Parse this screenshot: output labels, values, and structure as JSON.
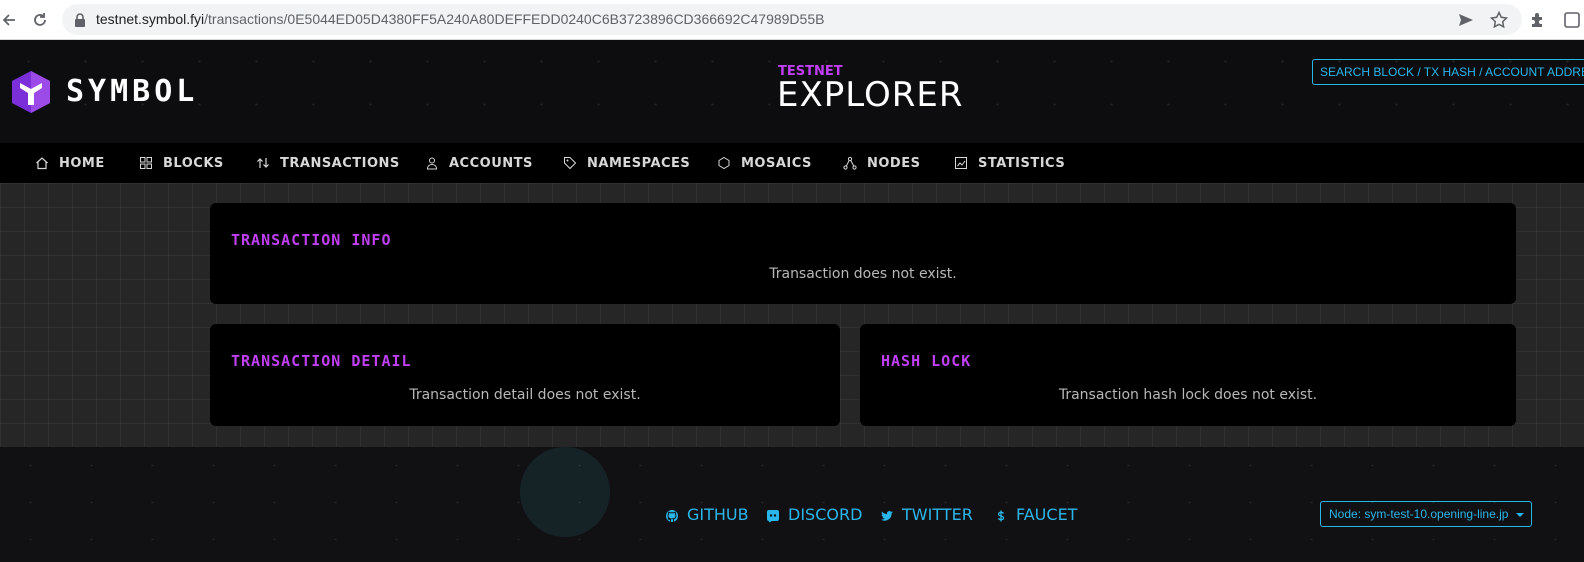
{
  "browser": {
    "url_host": "testnet.symbol.fyi",
    "url_path": "/transactions/0E5044ED05D4380FF5A240A80DEFFEDD0240C6B3723896CD366692C47989D55B",
    "icons": [
      "back-icon",
      "reload-icon",
      "lock-icon",
      "send-icon",
      "star-icon",
      "extensions-icon"
    ]
  },
  "header": {
    "logo_text": "SYMBOL",
    "network_label": "TESTNET",
    "title": "EXPLORER",
    "search_placeholder": "SEARCH BLOCK / TX HASH / ACCOUNT ADDRESS"
  },
  "menu": {
    "items": [
      {
        "label": "HOME",
        "icon": "home-icon"
      },
      {
        "label": "BLOCKS",
        "icon": "blocks-icon"
      },
      {
        "label": "TRANSACTIONS",
        "icon": "transactions-icon"
      },
      {
        "label": "ACCOUNTS",
        "icon": "accounts-icon"
      },
      {
        "label": "NAMESPACES",
        "icon": "tag-icon"
      },
      {
        "label": "MOSAICS",
        "icon": "mosaic-icon"
      },
      {
        "label": "NODES",
        "icon": "nodes-icon"
      },
      {
        "label": "STATISTICS",
        "icon": "chart-icon"
      }
    ]
  },
  "cards": {
    "info": {
      "title": "TRANSACTION INFO",
      "message": "Transaction does not exist."
    },
    "detail": {
      "title": "TRANSACTION DETAIL",
      "message": "Transaction detail does not exist."
    },
    "hashlock": {
      "title": "HASH LOCK",
      "message": "Transaction hash lock does not exist."
    }
  },
  "footer": {
    "links": [
      {
        "label": "GITHUB",
        "icon": "github-icon"
      },
      {
        "label": "DISCORD",
        "icon": "discord-icon"
      },
      {
        "label": "TWITTER",
        "icon": "twitter-icon"
      },
      {
        "label": "FAUCET",
        "icon": "dollar-icon"
      }
    ],
    "node_select": "Node: sym-test-10.opening-line.jp"
  },
  "colors": {
    "accent_purple": "#c03ff5",
    "accent_blue": "#2ab6e8",
    "card_bg": "#000000",
    "page_bg": "#262626"
  }
}
